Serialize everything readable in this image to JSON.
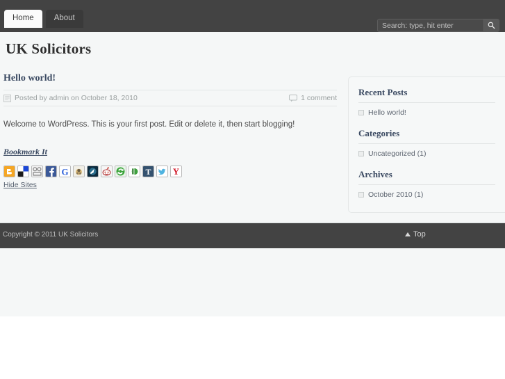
{
  "header": {
    "nav": [
      {
        "label": "Home",
        "active": true
      },
      {
        "label": "About",
        "active": false
      }
    ],
    "search": {
      "placeholder": "Search: type, hit enter",
      "value": "",
      "button_icon": "search-icon"
    }
  },
  "site": {
    "title": "UK Solicitors"
  },
  "post": {
    "title": "Hello world!",
    "meta_text": "Posted by admin on October 18, 2010",
    "meta_icon": "calendar-icon",
    "comments_text": "1 comment",
    "comments_icon": "comment-bubble-icon",
    "body": "Welcome to WordPress. This is your first post. Edit or delete it, then start blogging!"
  },
  "bookmark": {
    "title": "Bookmark It",
    "hide_label": "Hide Sites",
    "sites": [
      {
        "name": "blogger-icon",
        "label": "Blogger"
      },
      {
        "name": "delicious-icon",
        "label": "Delicious"
      },
      {
        "name": "diigo-icon",
        "label": "Diigo"
      },
      {
        "name": "facebook-icon",
        "label": "Facebook"
      },
      {
        "name": "google-icon",
        "label": "Google"
      },
      {
        "name": "mixx-icon",
        "label": "Mixx"
      },
      {
        "name": "netvibes-icon",
        "label": "Netvibes"
      },
      {
        "name": "reddit-icon",
        "label": "Reddit"
      },
      {
        "name": "stumbleupon-icon",
        "label": "StumbleUpon"
      },
      {
        "name": "technorati-icon",
        "label": "Technorati"
      },
      {
        "name": "tumblr-icon",
        "label": "Tumblr"
      },
      {
        "name": "twitter-icon",
        "label": "Twitter"
      },
      {
        "name": "yahoo-icon",
        "label": "Yahoo"
      }
    ]
  },
  "sidebar": {
    "widgets": [
      {
        "title": "Recent Posts",
        "items": [
          {
            "label": "Hello world!"
          }
        ]
      },
      {
        "title": "Categories",
        "items": [
          {
            "label": "Uncategorized (1)"
          }
        ]
      },
      {
        "title": "Archives",
        "items": [
          {
            "label": "October 2010 (1)"
          }
        ]
      }
    ]
  },
  "footer": {
    "copyright": "Copyright © 2011 UK Solicitors",
    "top_label": "Top"
  },
  "colors": {
    "header_bg": "#434343",
    "body_bg": "#f5f7f7",
    "heading": "#3b4a62",
    "footer_bg": "#434343"
  }
}
